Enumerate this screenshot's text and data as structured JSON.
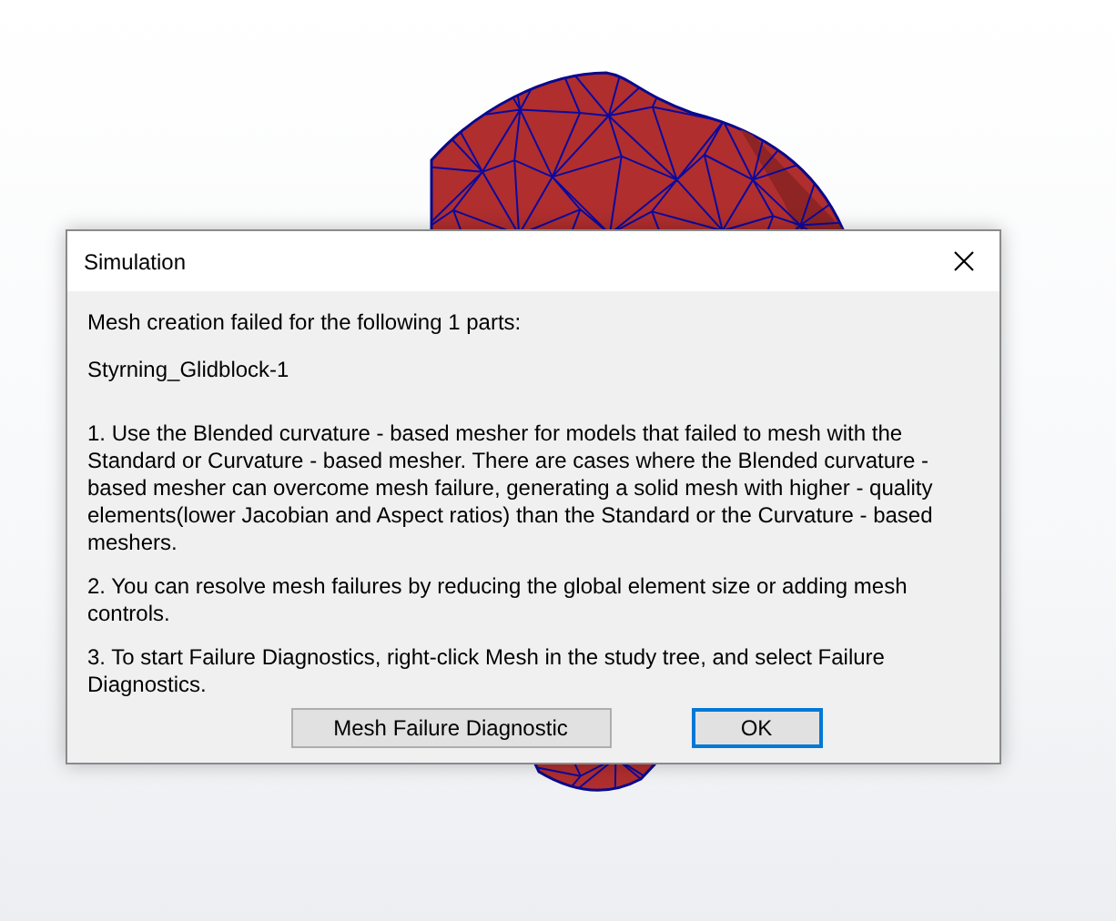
{
  "dialog": {
    "title": "Simulation",
    "heading": "Mesh creation failed for the following 1 parts:",
    "part_name": "Styrning_Glidblock-1",
    "paragraphs": [
      "1. Use the Blended curvature - based mesher for models that failed to mesh with the Standard or Curvature - based mesher. There are cases where the Blended curvature - based mesher can overcome mesh failure, generating a solid mesh with higher - quality elements(lower Jacobian and Aspect ratios) than the Standard or the Curvature - based meshers.",
      "2. You can resolve mesh failures by reducing the global element size or adding mesh controls.",
      "3. To start Failure Diagnostics, right-click Mesh in the study tree, and select Failure Diagnostics."
    ],
    "buttons": [
      {
        "label": "Mesh Failure Diagnostic",
        "default": false
      },
      {
        "label": "OK",
        "default": true
      }
    ]
  }
}
